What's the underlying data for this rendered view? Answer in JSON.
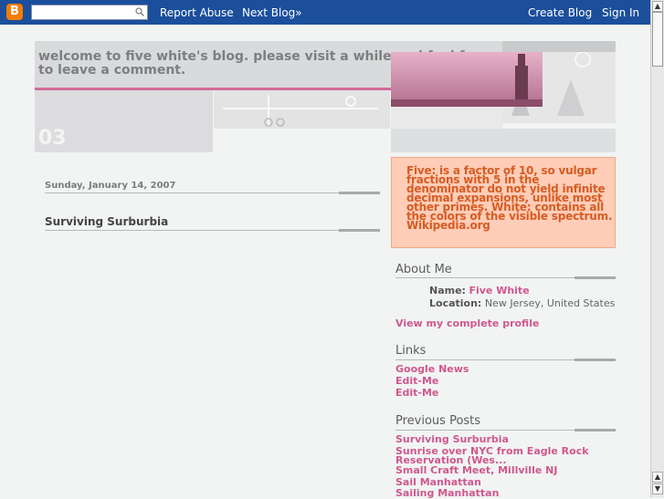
{
  "navbar": {
    "logo_letter": "B",
    "search_placeholder": "",
    "report_abuse": "Report Abuse",
    "next_blog": "Next Blog»",
    "create_blog": "Create Blog",
    "sign_in": "Sign In"
  },
  "header": {
    "title": "welcome to five white's blog. please visit a while and feel free to leave a comment.",
    "deco_number": "03"
  },
  "main": {
    "date": "Sunday, January 14, 2007",
    "post_title": "Surviving Surburbia"
  },
  "sidebar": {
    "description": "Five: is a factor of 10, so vulgar fractions with 5 in the denominator do not yield infinite decimal expansions, unlike most other primes. White: contains all the colors of the visible spectrum. Wikipedia.org",
    "about_me_heading": "About Me",
    "name_label": "Name:",
    "name_value": "Five White",
    "location_label": "Location:",
    "location_value": "New Jersey, United States",
    "profile_link": "View my complete profile",
    "links_heading": "Links",
    "links": [
      "Google News",
      "Edit-Me",
      "Edit-Me"
    ],
    "previous_heading": "Previous Posts",
    "previous_posts": [
      "Surviving Surburbia",
      "Sunrise over NYC from Eagle Rock Reservation (Wes...",
      "Small Craft Meet, Millville NJ",
      "Sail Manhattan",
      "Sailing Manhattan"
    ]
  },
  "colors": {
    "navbar": "#1b4f9c",
    "accent_pink": "#d0588d",
    "description_bg": "#ffcdb8",
    "description_text": "#d75c22"
  }
}
